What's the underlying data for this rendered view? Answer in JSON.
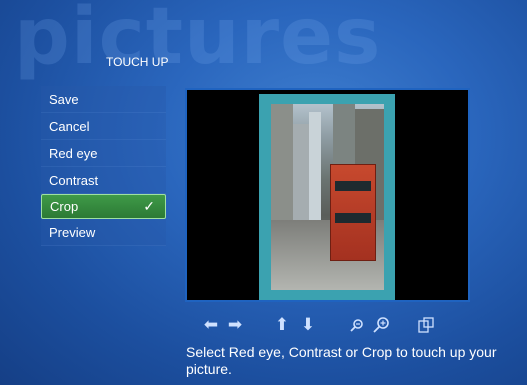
{
  "background_watermark": "pictures",
  "section_title": "TOUCH UP",
  "menu": {
    "items": [
      {
        "label": "Save",
        "selected": false
      },
      {
        "label": "Cancel",
        "selected": false
      },
      {
        "label": "Red eye",
        "selected": false
      },
      {
        "label": "Contrast",
        "selected": false
      },
      {
        "label": "Crop",
        "selected": true
      },
      {
        "label": "Preview",
        "selected": false
      }
    ],
    "selected_icon": "check-icon",
    "selected_color": "#3f9a48"
  },
  "controls": {
    "icons": [
      "arrow-left-icon",
      "arrow-right-icon",
      "arrow-up-icon",
      "arrow-down-icon",
      "zoom-out-icon",
      "zoom-in-icon",
      "crop-frame-icon"
    ]
  },
  "caption": "Select Red eye, Contrast or Crop to touch up your picture.",
  "colors": {
    "background": "#2a66bd",
    "viewer_border": "#1f63c0",
    "crop_frame": "#3ba2b0"
  }
}
